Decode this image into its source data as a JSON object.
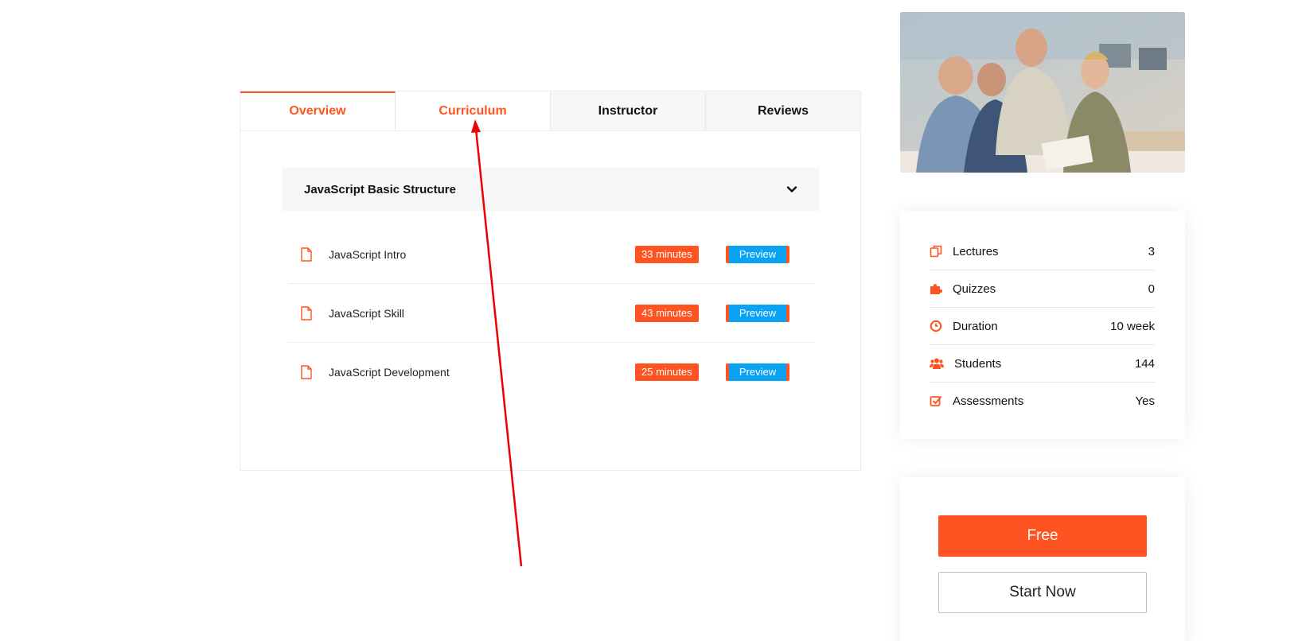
{
  "tabs": [
    {
      "label": "Overview"
    },
    {
      "label": "Curriculum"
    },
    {
      "label": "Instructor"
    },
    {
      "label": "Reviews"
    }
  ],
  "curriculum": {
    "section_title": "JavaScript Basic Structure",
    "lessons": [
      {
        "title": "JavaScript Intro",
        "duration": "33 minutes",
        "preview": "Preview"
      },
      {
        "title": "JavaScript Skill",
        "duration": "43 minutes",
        "preview": "Preview"
      },
      {
        "title": "JavaScript Development",
        "duration": "25 minutes",
        "preview": "Preview"
      }
    ]
  },
  "course_info": [
    {
      "label": "Lectures",
      "value": "3",
      "icon": "copy-icon"
    },
    {
      "label": "Quizzes",
      "value": "0",
      "icon": "puzzle-icon"
    },
    {
      "label": "Duration",
      "value": "10 week",
      "icon": "clock-icon"
    },
    {
      "label": "Students",
      "value": "144",
      "icon": "users-icon"
    },
    {
      "label": "Assessments",
      "value": "Yes",
      "icon": "checkbox-icon"
    }
  ],
  "cta": {
    "price_label": "Free",
    "start_label": "Start Now"
  },
  "colors": {
    "accent": "#ff5421",
    "preview_blue": "#0aa3f3",
    "annotation_red": "#ee0000"
  }
}
